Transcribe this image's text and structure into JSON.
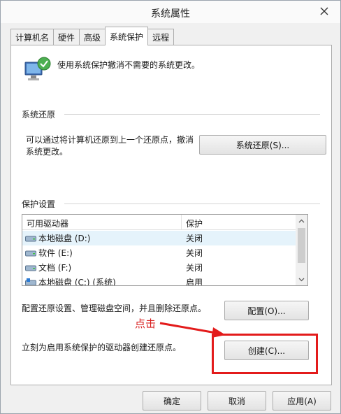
{
  "window": {
    "title": "系统属性"
  },
  "tabs": [
    {
      "label": "计算机名"
    },
    {
      "label": "硬件"
    },
    {
      "label": "高级"
    },
    {
      "label": "系统保护"
    },
    {
      "label": "远程"
    }
  ],
  "header": {
    "description": "使用系统保护撤消不需要的系统更改。"
  },
  "restore": {
    "section_title": "系统还原",
    "text_line1": "可以通过将计算机还原到上一个还原点，撤消",
    "text_line2": "系统更改。",
    "button": "系统还原(S)..."
  },
  "protection": {
    "section_title": "保护设置",
    "columns": [
      "可用驱动器",
      "保护"
    ],
    "drives": [
      {
        "name": "本地磁盘 (D:)",
        "state": "关闭"
      },
      {
        "name": "软件 (E:)",
        "state": "关闭"
      },
      {
        "name": "文档 (F:)",
        "state": "关闭"
      },
      {
        "name": "本地磁盘 (C:) (系统)",
        "state": "启用"
      }
    ],
    "configure_text": "配置还原设置、管理磁盘空间，并且删除还原点。",
    "configure_button": "配置(O)...",
    "create_text": "立刻为启用系统保护的驱动器创建还原点。",
    "create_button": "创建(C)..."
  },
  "annotation": {
    "label": "点击",
    "color": "#e31b1b"
  },
  "footer": {
    "ok": "确定",
    "cancel": "取消",
    "apply": "应用(A)"
  }
}
